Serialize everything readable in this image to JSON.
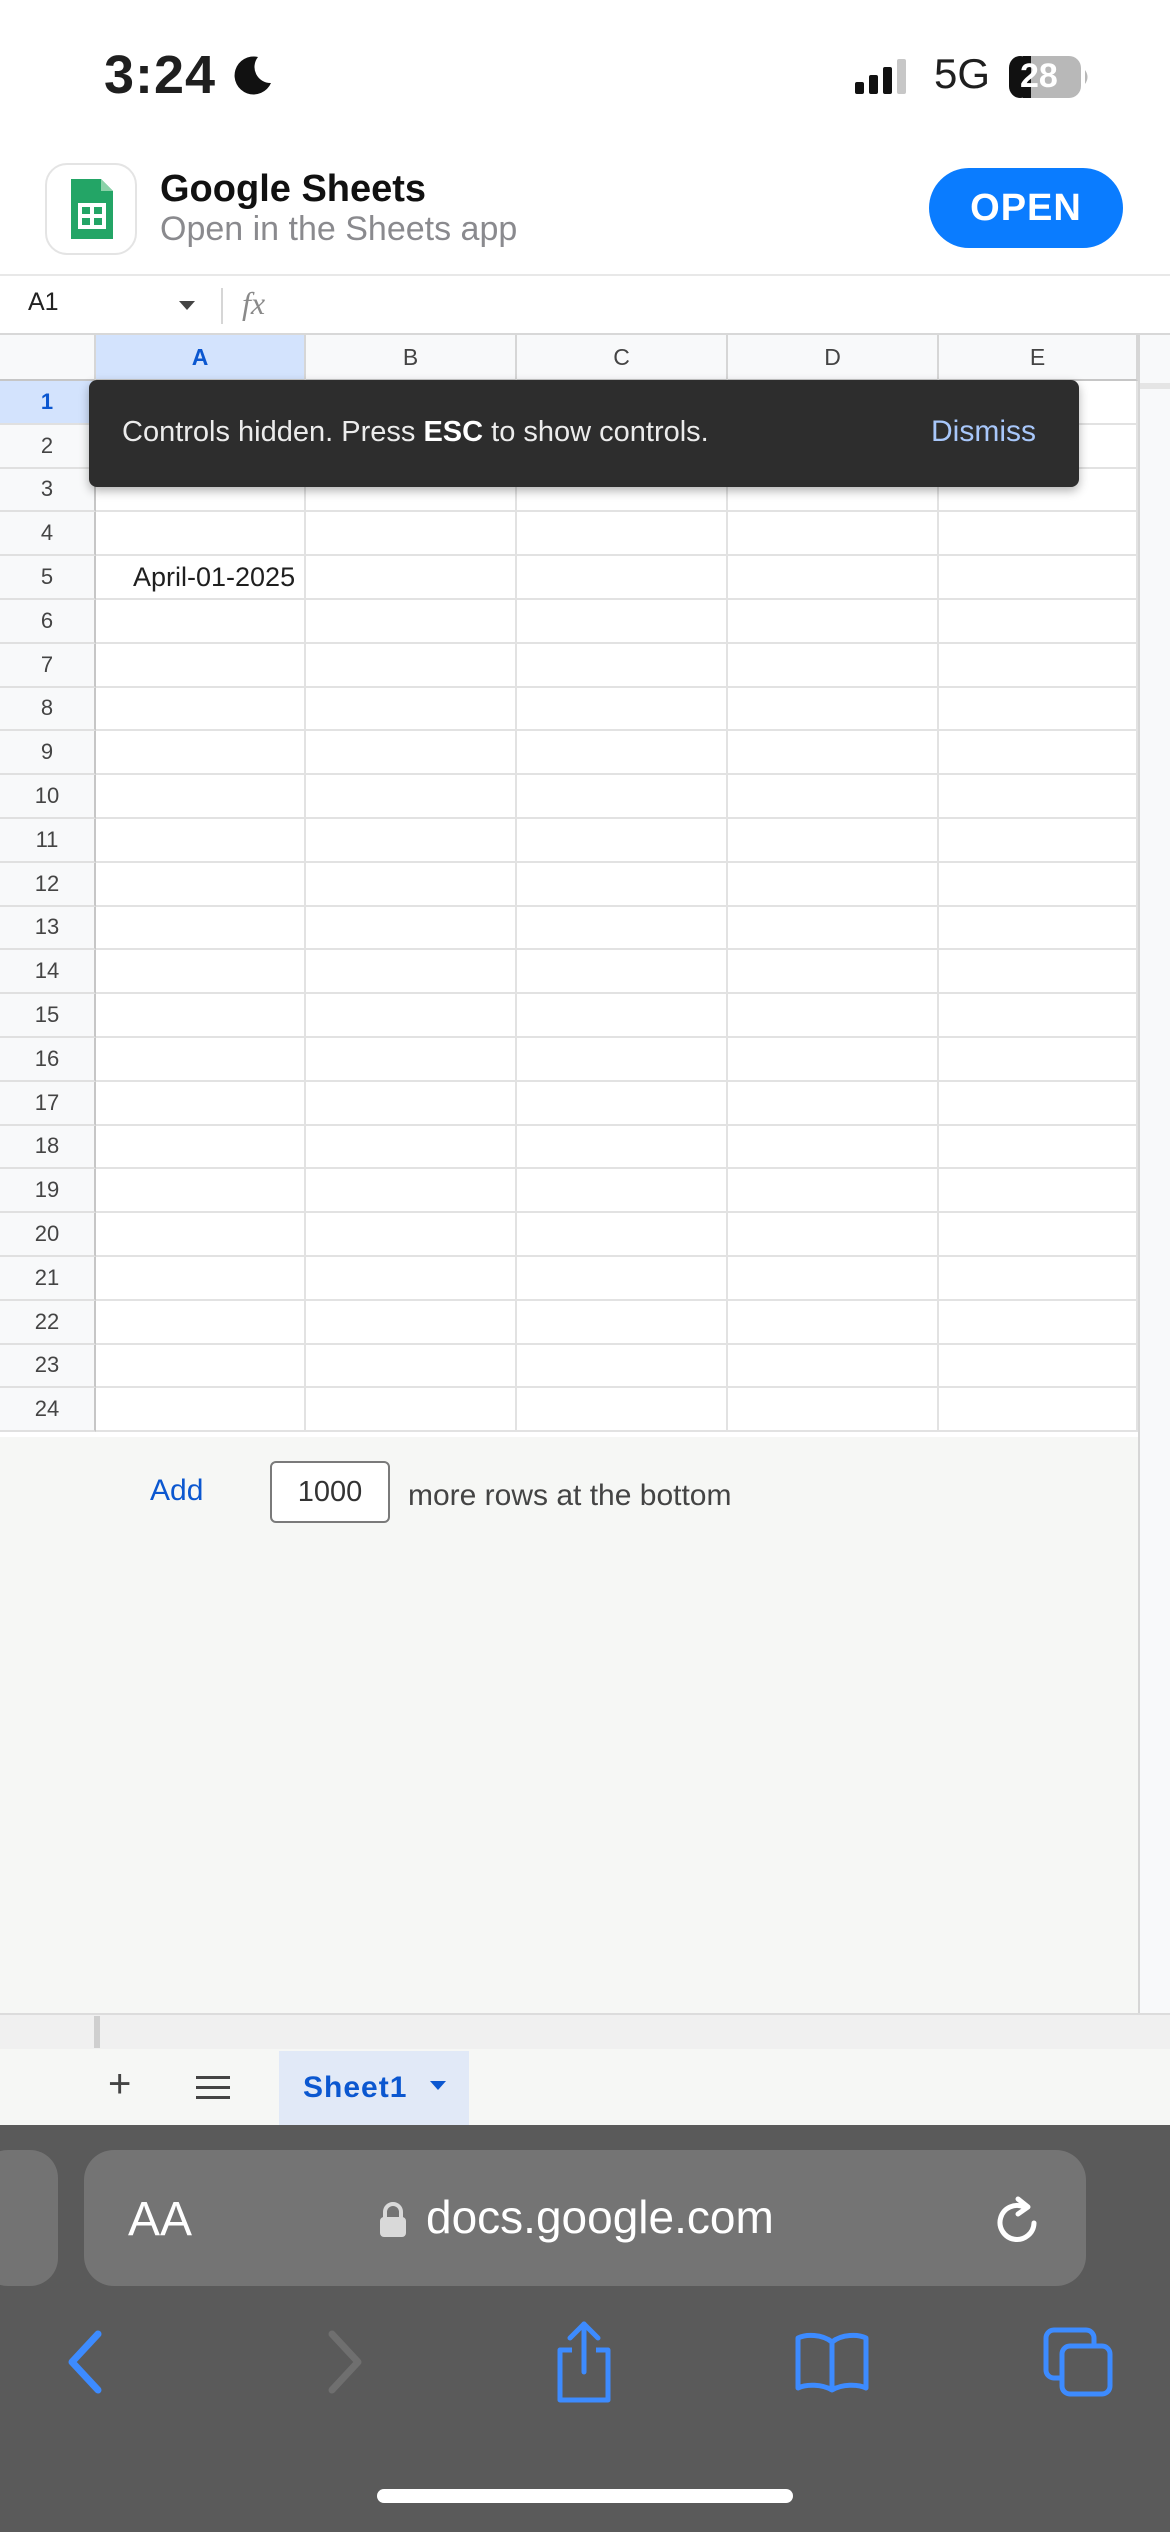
{
  "status_bar": {
    "time": "3:24",
    "network": "5G",
    "battery": "28"
  },
  "app_banner": {
    "title": "Google Sheets",
    "subtitle": "Open in the Sheets app",
    "open_label": "OPEN"
  },
  "formula_bar": {
    "cell_ref": "A1",
    "fx_label": "fx",
    "formula": ""
  },
  "grid": {
    "columns": [
      "A",
      "B",
      "C",
      "D",
      "E"
    ],
    "selected_column": "A",
    "rows": [
      "1",
      "2",
      "3",
      "4",
      "5",
      "6",
      "7",
      "8",
      "9",
      "10",
      "11",
      "12",
      "13",
      "14",
      "15",
      "16",
      "17",
      "18",
      "19",
      "20",
      "21",
      "22",
      "23",
      "24"
    ],
    "selected_row": "1",
    "cells": {
      "A5": "April-01-2025"
    }
  },
  "toast": {
    "text_before": "Controls hidden. Press ",
    "key": "ESC",
    "text_after": " to show controls.",
    "dismiss_label": "Dismiss"
  },
  "add_rows": {
    "add_label": "Add",
    "count": "1000",
    "suffix": "more rows at the bottom"
  },
  "sheet_tabs": {
    "add_icon": "+",
    "tabs": [
      {
        "label": "Sheet1",
        "active": true
      }
    ]
  },
  "browser": {
    "aa_label": "AA",
    "url": "docs.google.com"
  },
  "colors": {
    "accent": "#0b57d0",
    "open_button": "#0a7cff",
    "selected_header": "#d3e3fd",
    "toast_bg": "#2d2d2d",
    "sheets_green": "#23a566"
  }
}
